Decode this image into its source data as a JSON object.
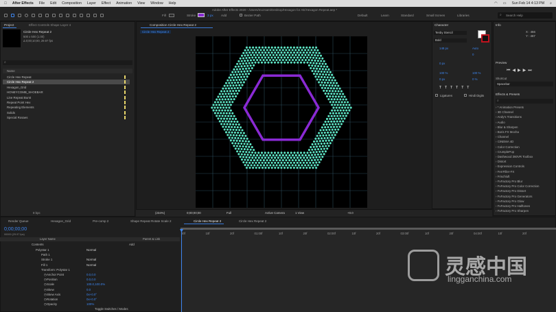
{
  "menubar": {
    "app": "After Effects",
    "items": [
      "File",
      "Edit",
      "Composition",
      "Layer",
      "Effect",
      "Animation",
      "View",
      "Window",
      "Help"
    ],
    "datetime": "Sun Feb 14  4:13 PM"
  },
  "toolbar": {
    "document_title": "Adobe After Effects 2020 - /Users/mozsam/Desktop/Hexagon for AE/Hexagon Repeat.aep *",
    "fill_label": "Fill",
    "stroke_label": "Stroke",
    "stroke_width": "3 px",
    "add_label": "Add",
    "bezier_path": "Bezier Path",
    "workspaces": [
      "Default",
      "Learn",
      "Standard",
      "Small Screen",
      "Libraries"
    ],
    "search_help": "Search Help"
  },
  "project": {
    "tab": "Project",
    "effect_controls_tab": "Effect Controls Shape Layer 4",
    "selected_name": "Circle Hex Repeat 2",
    "selected_size": "500 x 500 (1.00)",
    "selected_duration": "Δ 0;00;10;00, 29.97 fps",
    "col_name": "Name",
    "items": [
      {
        "name": "Circle Hex Repeat",
        "color": "#e8d66a",
        "selected": false
      },
      {
        "name": "Circle Hex Repeat 2",
        "color": "#e8d66a",
        "selected": true
      },
      {
        "name": "Hexagon_Grid",
        "color": "#e8d66a",
        "selected": false
      },
      {
        "name": "HONEYCOMB_SHOEBAR",
        "color": "#e8d66a",
        "selected": false
      },
      {
        "name": "Line Repeat Burst",
        "color": "#e8d66a",
        "selected": false
      },
      {
        "name": "Repeat Point Hex",
        "color": "#e8d66a",
        "selected": false
      },
      {
        "name": "Repeating Elements",
        "color": "#e8d66a",
        "selected": false
      },
      {
        "name": "Solids",
        "color": "#e8d66a",
        "selected": false
      },
      {
        "name": "Special Rosaes",
        "color": "#e8d66a",
        "selected": false
      }
    ],
    "bpc": "8 bpc"
  },
  "composition": {
    "tab": "Composition  Circle Hex Repeat 2",
    "subtab": "Circle Hex Repeat 2",
    "zoom": "(234%)",
    "timecode": "0;00;00;00",
    "quality": "Full",
    "camera": "Active Camera",
    "view": "1 View",
    "offset": "+0.0",
    "hex_fill": "#00000000",
    "dot_color": "#5de3c3",
    "stroke_color": "#8a2ad4",
    "grid_color": "#2a4a58"
  },
  "info": {
    "tab": "Info",
    "x": "X : 466",
    "y": "Y : 467"
  },
  "preview": {
    "tab": "Preview",
    "shortcut_label": "Shortcut",
    "shortcut_value": "Spacebar"
  },
  "character": {
    "tab": "Character",
    "font": "Tenby Stencil",
    "style": "Bold",
    "size": "148 px",
    "leading": "Auto",
    "tracking": "0",
    "stroke_width": "0 px",
    "scale_v": "100 %",
    "scale_h": "100 %",
    "baseline": "0 px",
    "tsume": "0 %",
    "ligatures": "Ligatures",
    "hindi": "Hindi Digits"
  },
  "effects": {
    "tab": "Effects & Presets",
    "items": [
      "* Animation Presets",
      "3D Channel",
      "Andy's Transitions",
      "Audio",
      "Blur & Sharpen",
      "Boris FX Mocha",
      "Channel",
      "CINEMA 4D",
      "Color Correction",
      "CrumplePop",
      "Dashwood 360VR Toolbox",
      "Distort",
      "Expression Controls",
      "FerrFiller-FX",
      "Frischluft",
      "FxFactory Pro Blur",
      "FxFactory Pro Color Correction",
      "FxFactory Pro Distort",
      "FxFactory Pro Generators",
      "FxFactory Pro Glow",
      "FxFactory Pro Halftones",
      "FxFactory Pro Sharpen"
    ]
  },
  "timeline": {
    "tabs": [
      "Render Queue",
      "Hexagon_Grid",
      "Pre-comp 2",
      "Shape Repeat Rotate Scale 2",
      "Circle Hex Repeat 2",
      "Circle Hex Repeat 2"
    ],
    "active_tab_index": 4,
    "timecode": "0;00;00;00",
    "frame_info": "00000 (29.97 fps)",
    "col_layer": "Layer Name",
    "col_parent": "Parent & Link",
    "contents_label": "Contents",
    "add_label": "Add",
    "rows": [
      {
        "indent": 0,
        "label": "Polystar 1",
        "value": "Normal"
      },
      {
        "indent": 1,
        "label": "Path 1",
        "value": ""
      },
      {
        "indent": 1,
        "label": "Stroke 1",
        "value": "Normal"
      },
      {
        "indent": 1,
        "label": "Fill 1",
        "value": "Normal"
      },
      {
        "indent": 1,
        "label": "Transform: Polystar 1",
        "value": ""
      },
      {
        "indent": 2,
        "label": "Anchor Point",
        "value": "0.0,0.0"
      },
      {
        "indent": 2,
        "label": "Position",
        "value": "0.0,0.0"
      },
      {
        "indent": 2,
        "label": "Scale",
        "value": "100.0,100.0%"
      },
      {
        "indent": 2,
        "label": "Skew",
        "value": "0.0"
      },
      {
        "indent": 2,
        "label": "Skew Axis",
        "value": "0x+0.0°"
      },
      {
        "indent": 2,
        "label": "Rotation",
        "value": "0x+0.0°"
      },
      {
        "indent": 2,
        "label": "Opacity",
        "value": "100%"
      }
    ],
    "toggle": "Toggle Switches / Modes",
    "ruler": [
      "00f",
      "10f",
      "20f",
      "01:00f",
      "10f",
      "20f",
      "02:00f",
      "10f",
      "20f",
      "03:00f",
      "10f",
      "20f",
      "04:00f",
      "10f",
      "20f"
    ]
  },
  "watermark": {
    "cn": "灵感中国",
    "en": "lingganchina.com"
  }
}
